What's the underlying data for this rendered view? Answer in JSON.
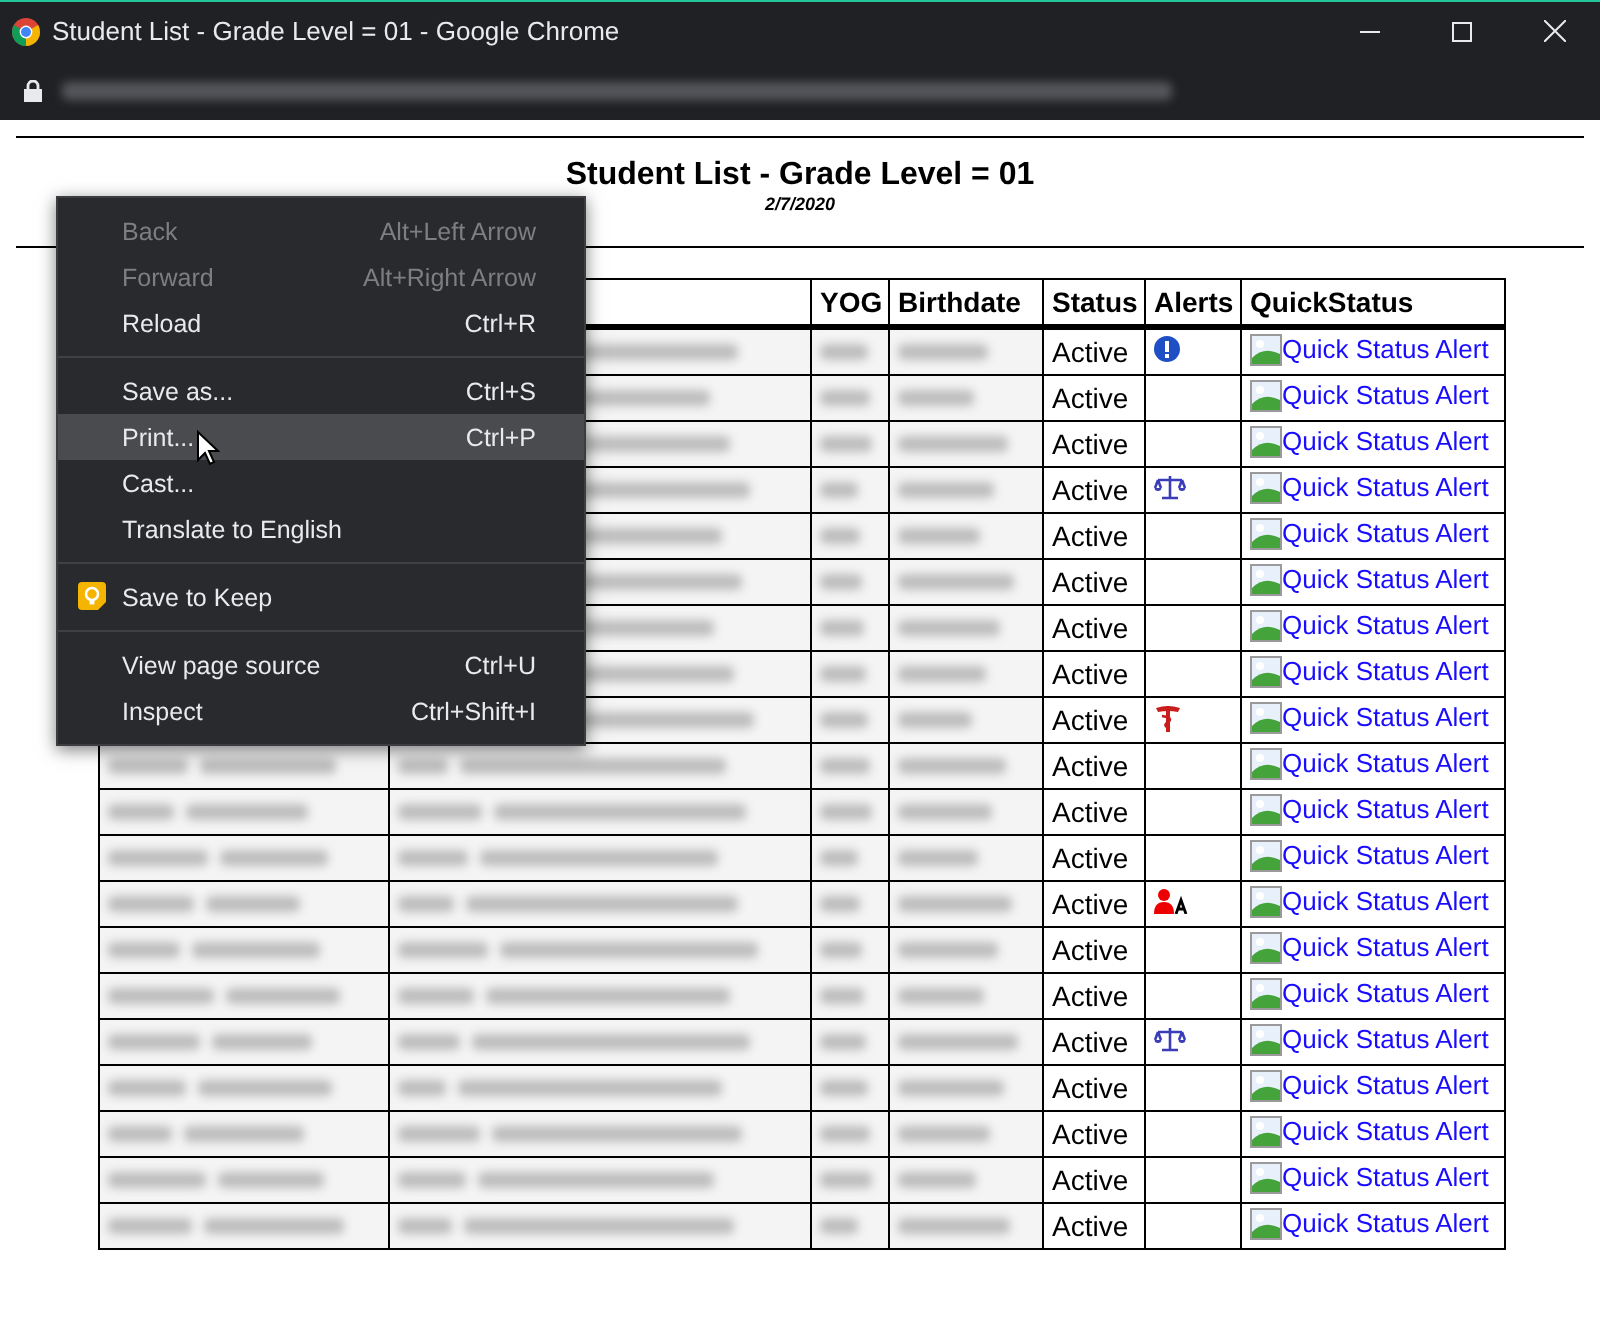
{
  "window": {
    "title": "Student List - Grade Level = 01 - Google Chrome"
  },
  "page": {
    "title": "Student List - Grade Level = 01",
    "date": "2/7/2020"
  },
  "table": {
    "columns": [
      "YOG",
      "Birthdate",
      "Status",
      "Alerts",
      "QuickStatus"
    ],
    "rows": [
      {
        "status": "Active",
        "alert": {
          "kind": "info"
        },
        "link": "Quick Status Alert"
      },
      {
        "status": "Active",
        "link": "Quick Status Alert"
      },
      {
        "status": "Active",
        "link": "Quick Status Alert"
      },
      {
        "status": "Active",
        "alert": {
          "kind": "scales"
        },
        "link": "Quick Status Alert"
      },
      {
        "status": "Active",
        "link": "Quick Status Alert"
      },
      {
        "status": "Active",
        "link": "Quick Status Alert"
      },
      {
        "status": "Active",
        "link": "Quick Status Alert"
      },
      {
        "status": "Active",
        "link": "Quick Status Alert"
      },
      {
        "status": "Active",
        "alert": {
          "kind": "medical"
        },
        "link": "Quick Status Alert"
      },
      {
        "status": "Active",
        "link": "Quick Status Alert"
      },
      {
        "status": "Active",
        "link": "Quick Status Alert"
      },
      {
        "status": "Active",
        "link": "Quick Status Alert"
      },
      {
        "status": "Active",
        "alert": {
          "kind": "person"
        },
        "link": "Quick Status Alert"
      },
      {
        "status": "Active",
        "link": "Quick Status Alert"
      },
      {
        "status": "Active",
        "link": "Quick Status Alert"
      },
      {
        "status": "Active",
        "alert": {
          "kind": "scales"
        },
        "link": "Quick Status Alert"
      },
      {
        "status": "Active",
        "link": "Quick Status Alert"
      },
      {
        "status": "Active",
        "link": "Quick Status Alert"
      },
      {
        "status": "Active",
        "link": "Quick Status Alert"
      },
      {
        "status": "Active",
        "link": "Quick Status Alert"
      }
    ]
  },
  "context_menu": {
    "items": [
      {
        "kind": "item",
        "label": "Back",
        "shortcut": "Alt+Left Arrow",
        "disabled": true,
        "selected": false
      },
      {
        "kind": "item",
        "label": "Forward",
        "shortcut": "Alt+Right Arrow",
        "disabled": true,
        "selected": false
      },
      {
        "kind": "item",
        "label": "Reload",
        "shortcut": "Ctrl+R",
        "disabled": false,
        "selected": false
      },
      {
        "kind": "separator"
      },
      {
        "kind": "item",
        "label": "Save as...",
        "shortcut": "Ctrl+S",
        "disabled": false,
        "selected": false
      },
      {
        "kind": "item",
        "label": "Print...",
        "shortcut": "Ctrl+P",
        "disabled": false,
        "selected": true
      },
      {
        "kind": "item",
        "label": "Cast...",
        "disabled": false,
        "selected": false
      },
      {
        "kind": "item",
        "label": "Translate to English",
        "disabled": false,
        "selected": false
      },
      {
        "kind": "separator"
      },
      {
        "kind": "keep",
        "label": "Save to Keep",
        "disabled": false,
        "selected": false
      },
      {
        "kind": "separator"
      },
      {
        "kind": "item",
        "label": "View page source",
        "shortcut": "Ctrl+U",
        "disabled": false,
        "selected": false
      },
      {
        "kind": "item",
        "label": "Inspect",
        "shortcut": "Ctrl+Shift+I",
        "disabled": false,
        "selected": false
      }
    ]
  }
}
